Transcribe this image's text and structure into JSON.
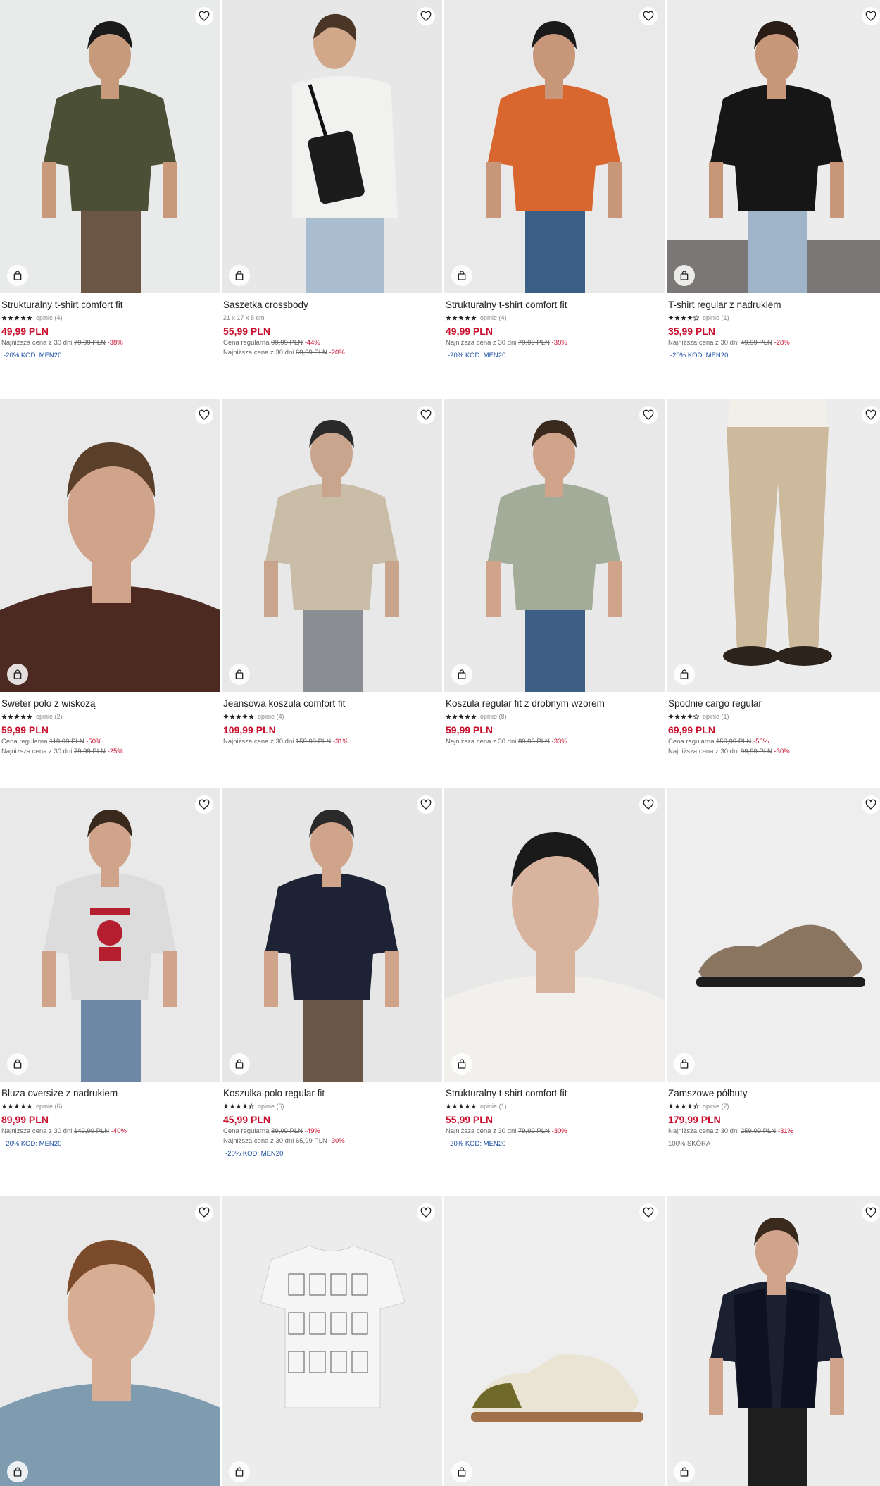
{
  "products": [
    {
      "name": "Strukturalny t-shirt comfort fit",
      "stars": 5,
      "reviews": "opinie (4)",
      "price": "49,99 PLN",
      "lines": [
        {
          "label": "Najniższa cena z 30 dni",
          "old": "79,99 PLN",
          "pct": "-38%"
        }
      ],
      "promo": "-20% KOD: MEN20"
    },
    {
      "name": "Saszetka crossbody",
      "dims": "21 x 17 x 8 cm",
      "price": "55,99 PLN",
      "lines": [
        {
          "label": "Cena regularna",
          "old": "99,99 PLN",
          "pct": "-44%"
        },
        {
          "label": "Najniższa cena z 30 dni",
          "old": "69,99 PLN",
          "pct": "-20%"
        }
      ]
    },
    {
      "name": "Strukturalny t-shirt comfort fit",
      "stars": 5,
      "reviews": "opinie (4)",
      "price": "49,99 PLN",
      "lines": [
        {
          "label": "Najniższa cena z 30 dni",
          "old": "79,99 PLN",
          "pct": "-38%"
        }
      ],
      "promo": "-20% KOD: MEN20"
    },
    {
      "name": "T-shirt regular z nadrukiem",
      "stars": 4,
      "reviews": "opinie (1)",
      "price": "35,99 PLN",
      "lines": [
        {
          "label": "Najniższa cena z 30 dni",
          "old": "49,99 PLN",
          "pct": "-28%"
        }
      ],
      "promo": "-20% KOD: MEN20"
    },
    {
      "name": "Sweter polo z wiskozą",
      "stars": 5,
      "reviews": "opinie (2)",
      "price": "59,99 PLN",
      "lines": [
        {
          "label": "Cena regularna",
          "old": "119,99 PLN",
          "pct": "-50%"
        },
        {
          "label": "Najniższa cena z 30 dni",
          "old": "79,99 PLN",
          "pct": "-25%"
        }
      ]
    },
    {
      "name": "Jeansowa koszula comfort fit",
      "stars": 5,
      "reviews": "opinie (4)",
      "price": "109,99 PLN",
      "lines": [
        {
          "label": "Najniższa cena z 30 dni",
          "old": "159,99 PLN",
          "pct": "-31%"
        }
      ]
    },
    {
      "name": "Koszula regular fit z drobnym wzorem",
      "stars": 5,
      "reviews": "opinie (8)",
      "price": "59,99 PLN",
      "lines": [
        {
          "label": "Najniższa cena z 30 dni",
          "old": "89,99 PLN",
          "pct": "-33%"
        }
      ]
    },
    {
      "name": "Spodnie cargo regular",
      "stars": 4,
      "reviews": "opinie (1)",
      "price": "69,99 PLN",
      "lines": [
        {
          "label": "Cena regularna",
          "old": "159,99 PLN",
          "pct": "-56%"
        },
        {
          "label": "Najniższa cena z 30 dni",
          "old": "99,99 PLN",
          "pct": "-30%"
        }
      ]
    },
    {
      "name": "Bluza oversize z nadrukiem",
      "stars": 5,
      "reviews": "opinie (6)",
      "price": "89,99 PLN",
      "lines": [
        {
          "label": "Najniższa cena z 30 dni",
          "old": "149,99 PLN",
          "pct": "-40%"
        }
      ],
      "promo": "-20% KOD: MEN20"
    },
    {
      "name": "Koszulka polo regular fit",
      "stars": 4.5,
      "reviews": "opinie (6)",
      "price": "45,99 PLN",
      "lines": [
        {
          "label": "Cena regularna",
          "old": "89,99 PLN",
          "pct": "-49%"
        },
        {
          "label": "Najniższa cena z 30 dni",
          "old": "65,99 PLN",
          "pct": "-30%"
        }
      ],
      "promo": "-20% KOD: MEN20"
    },
    {
      "name": "Strukturalny t-shirt comfort fit",
      "stars": 5,
      "reviews": "opinie (1)",
      "price": "55,99 PLN",
      "lines": [
        {
          "label": "Najniższa cena z 30 dni",
          "old": "79,99 PLN",
          "pct": "-30%"
        }
      ],
      "promo": "-20% KOD: MEN20"
    },
    {
      "name": "Zamszowe półbuty",
      "stars": 4.5,
      "reviews": "opinie (7)",
      "price": "179,99 PLN",
      "lines": [
        {
          "label": "Najniższa cena z 30 dni",
          "old": "259,99 PLN",
          "pct": "-31%"
        }
      ],
      "extra": "100% SKÓRA"
    },
    {
      "name": ""
    },
    {
      "name": ""
    },
    {
      "name": ""
    },
    {
      "name": ""
    }
  ],
  "icons": {
    "favorite": "heart-outline-icon",
    "cart": "shopping-bag-icon",
    "rating": "star-icon"
  },
  "colors": {
    "price": "#c8102e",
    "promo": "#1a4fa3",
    "star": "#222222"
  }
}
